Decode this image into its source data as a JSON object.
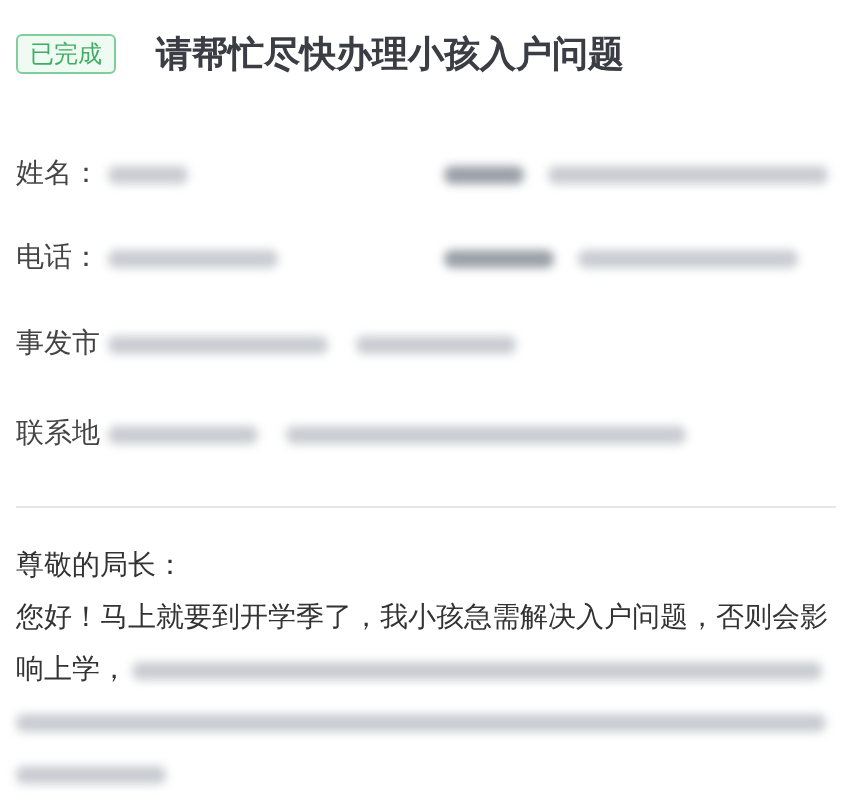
{
  "status_tag": {
    "label": "已完成"
  },
  "title": "请帮忙尽快办理小孩入户问题",
  "fields": [
    {
      "label": "姓名：",
      "redacted": true,
      "right_redacted": true
    },
    {
      "label": "电话：",
      "redacted": true,
      "right_redacted": true
    },
    {
      "label": "事发市",
      "redacted": true,
      "right_redacted": false
    },
    {
      "label": "联系地",
      "redacted": true,
      "right_redacted": false
    }
  ],
  "letter": {
    "salutation": "尊敬的局长：",
    "body": "您好！马上就要到开学季了，我小孩急需解决入户问题，否则会影响上学，",
    "body_redacted": true
  }
}
